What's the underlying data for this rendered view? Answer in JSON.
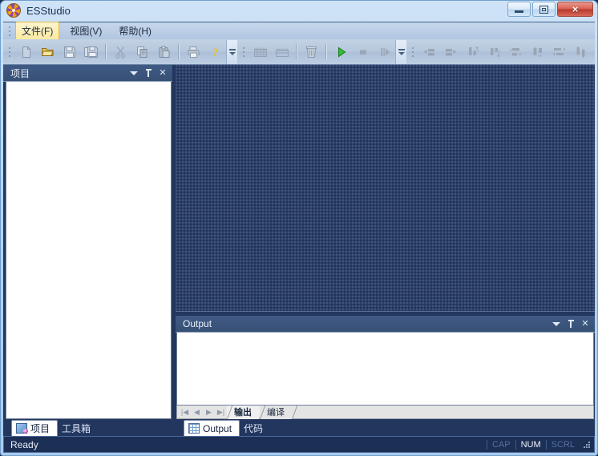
{
  "window": {
    "title": "ESStudio",
    "app_icon": "starburst-icon",
    "buttons": {
      "minimize": "minimize-icon",
      "maximize": "maximize-icon",
      "close": "×"
    }
  },
  "menubar": {
    "items": [
      {
        "label": "文件(F)",
        "text": "文件(",
        "accel": "F",
        "tail": ")",
        "active": true
      },
      {
        "label": "视图(V)",
        "text": "视图(",
        "accel": "V",
        "tail": ")",
        "active": false
      },
      {
        "label": "帮助(H)",
        "text": "帮助(",
        "accel": "H",
        "tail": ")",
        "active": false
      }
    ]
  },
  "toolbar": {
    "groups": [
      {
        "name": "file-group",
        "buttons": [
          {
            "name": "new-file-icon",
            "title": "New"
          },
          {
            "name": "open-folder-icon",
            "title": "Open"
          },
          {
            "name": "save-icon",
            "title": "Save"
          },
          {
            "name": "save-all-icon",
            "title": "Save All"
          }
        ]
      },
      {
        "name": "clipboard-group",
        "buttons": [
          {
            "name": "cut-scissors-icon",
            "title": "Cut"
          },
          {
            "name": "copy-icon",
            "title": "Copy"
          },
          {
            "name": "paste-icon",
            "title": "Paste"
          }
        ]
      },
      {
        "name": "print-help-group",
        "buttons": [
          {
            "name": "print-icon",
            "title": "Print"
          },
          {
            "name": "help-question-icon",
            "title": "Help"
          }
        ]
      },
      {
        "name": "table-group",
        "buttons": [
          {
            "name": "add-table-icon",
            "title": "Add Table"
          },
          {
            "name": "edit-table-icon",
            "title": "Edit Table"
          }
        ]
      },
      {
        "name": "delete-group",
        "buttons": [
          {
            "name": "trash-delete-icon",
            "title": "Delete"
          }
        ]
      },
      {
        "name": "run-group",
        "buttons": [
          {
            "name": "run-play-icon",
            "title": "Run"
          },
          {
            "name": "stop-square-icon",
            "title": "Stop"
          },
          {
            "name": "step-over-icon",
            "title": "Step"
          }
        ]
      },
      {
        "name": "align-group",
        "buttons": [
          {
            "name": "align-left-icon",
            "title": "Align Left"
          },
          {
            "name": "align-right-icon",
            "title": "Align Right"
          },
          {
            "name": "align-top-icon",
            "title": "Align Top"
          },
          {
            "name": "align-bottom-icon",
            "title": "Align Bottom"
          },
          {
            "name": "make-same-width-icon",
            "title": "Same Width"
          },
          {
            "name": "make-same-height-icon",
            "title": "Same Height"
          },
          {
            "name": "space-across-icon",
            "title": "Space Across"
          },
          {
            "name": "space-down-icon",
            "title": "Space Down"
          },
          {
            "name": "size-to-width-icon",
            "title": "Size To Width"
          },
          {
            "name": "size-to-grid-icon",
            "title": "Size To Grid"
          },
          {
            "name": "center-vertical-icon",
            "title": "Center Vertically"
          },
          {
            "name": "bring-to-front-icon",
            "title": "Bring To Front"
          },
          {
            "name": "send-to-back-icon",
            "title": "Send To Back"
          }
        ]
      }
    ],
    "overflow_label": "toolbar-overflow-chevron"
  },
  "project_panel": {
    "title": "项目",
    "caption_buttons": [
      {
        "name": "panel-dropdown-icon"
      },
      {
        "name": "panel-pin-icon"
      },
      {
        "name": "panel-close-icon",
        "glyph": "✕"
      }
    ],
    "content": "",
    "tabs": [
      {
        "label": "项目",
        "icon": "project-icon",
        "active": true
      },
      {
        "label": "工具箱",
        "icon": "toolbox-icon",
        "active": false
      }
    ]
  },
  "output_panel": {
    "title": "Output",
    "caption_buttons": [
      {
        "name": "panel-dropdown-icon"
      },
      {
        "name": "panel-pin-icon"
      },
      {
        "name": "panel-close-icon",
        "glyph": "✕"
      }
    ],
    "content": "",
    "sheet_nav": [
      {
        "name": "first-sheet-button",
        "glyph": "|◀"
      },
      {
        "name": "prev-sheet-button",
        "glyph": "◀"
      },
      {
        "name": "next-sheet-button",
        "glyph": "▶"
      },
      {
        "name": "last-sheet-button",
        "glyph": "▶|"
      }
    ],
    "sheet_tabs": [
      {
        "label": "输出",
        "active": true
      },
      {
        "label": "编译",
        "active": false
      }
    ],
    "dock_tabs": [
      {
        "label": "Output",
        "icon": "output-grid-icon",
        "active": true
      },
      {
        "label": "代码",
        "icon": "code-icon",
        "active": false
      }
    ]
  },
  "statusbar": {
    "message": "Ready",
    "indicators": [
      {
        "label": "CAP",
        "on": false
      },
      {
        "label": "NUM",
        "on": true
      },
      {
        "label": "SCRL",
        "on": false
      }
    ],
    "resize_grip": "resize-grip-icon"
  },
  "colors": {
    "window_chrome": "#b9d6f2",
    "dark_dock": "#22365e",
    "panel_caption": "#3f5a85",
    "editor_bg": "#2b3f66",
    "accent_yellow": "#fbe9a4",
    "close_red": "#d9604f",
    "run_green": "#2fa62f"
  }
}
